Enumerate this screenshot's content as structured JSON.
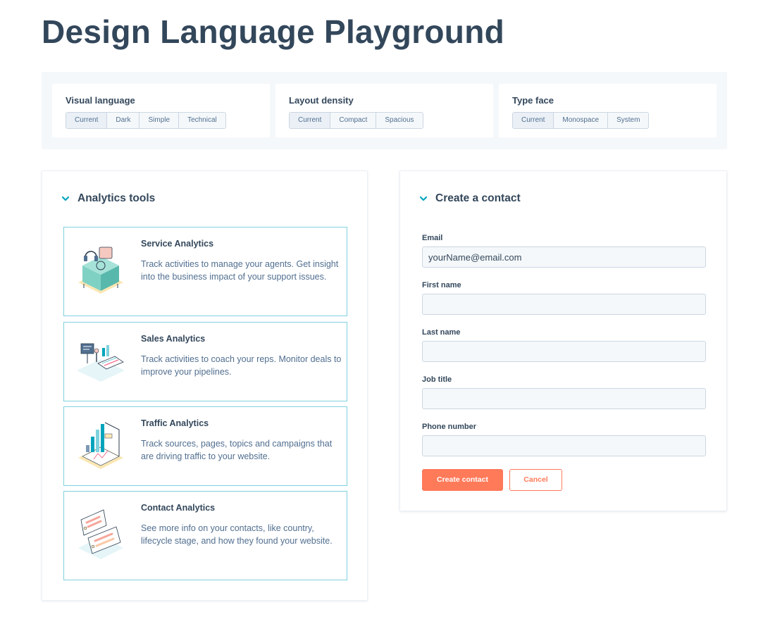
{
  "page": {
    "title": "Design Language Playground"
  },
  "settings": {
    "visual_language": {
      "title": "Visual language",
      "options": [
        "Current",
        "Dark",
        "Simple",
        "Technical"
      ],
      "selected": "Current"
    },
    "layout_density": {
      "title": "Layout density",
      "options": [
        "Current",
        "Compact",
        "Spacious"
      ],
      "selected": "Current"
    },
    "type_face": {
      "title": "Type face",
      "options": [
        "Current",
        "Monospace",
        "System"
      ],
      "selected": "Current"
    }
  },
  "analytics": {
    "title": "Analytics tools",
    "tools": [
      {
        "title": "Service Analytics",
        "description": "Track activities to manage your agents. Get insight into the business impact of your support issues.",
        "icon": "service-analytics-illustration"
      },
      {
        "title": "Sales Analytics",
        "description": "Track activities to coach your reps. Monitor deals to improve your pipelines.",
        "icon": "sales-analytics-illustration"
      },
      {
        "title": "Traffic Analytics",
        "description": "Track sources, pages, topics and campaigns that are driving traffic to your website.",
        "icon": "traffic-analytics-illustration"
      },
      {
        "title": "Contact Analytics",
        "description": "See more info on your contacts, like country, lifecycle stage, and how they found your website.",
        "icon": "contact-analytics-illustration"
      }
    ]
  },
  "contact_form": {
    "title": "Create a contact",
    "fields": [
      {
        "label": "Email",
        "value": "yourName@email.com"
      },
      {
        "label": "First name",
        "value": ""
      },
      {
        "label": "Last name",
        "value": ""
      },
      {
        "label": "Job title",
        "value": ""
      },
      {
        "label": "Phone number",
        "value": ""
      }
    ],
    "submit_label": "Create contact",
    "cancel_label": "Cancel"
  },
  "colors": {
    "heading": "#33475b",
    "body_text": "#516f90",
    "accent_teal": "#00a4bd",
    "card_border": "#7fd1de",
    "primary_button": "#ff7a59",
    "input_bg": "#f5f8fa",
    "input_border": "#cbd6e2"
  }
}
